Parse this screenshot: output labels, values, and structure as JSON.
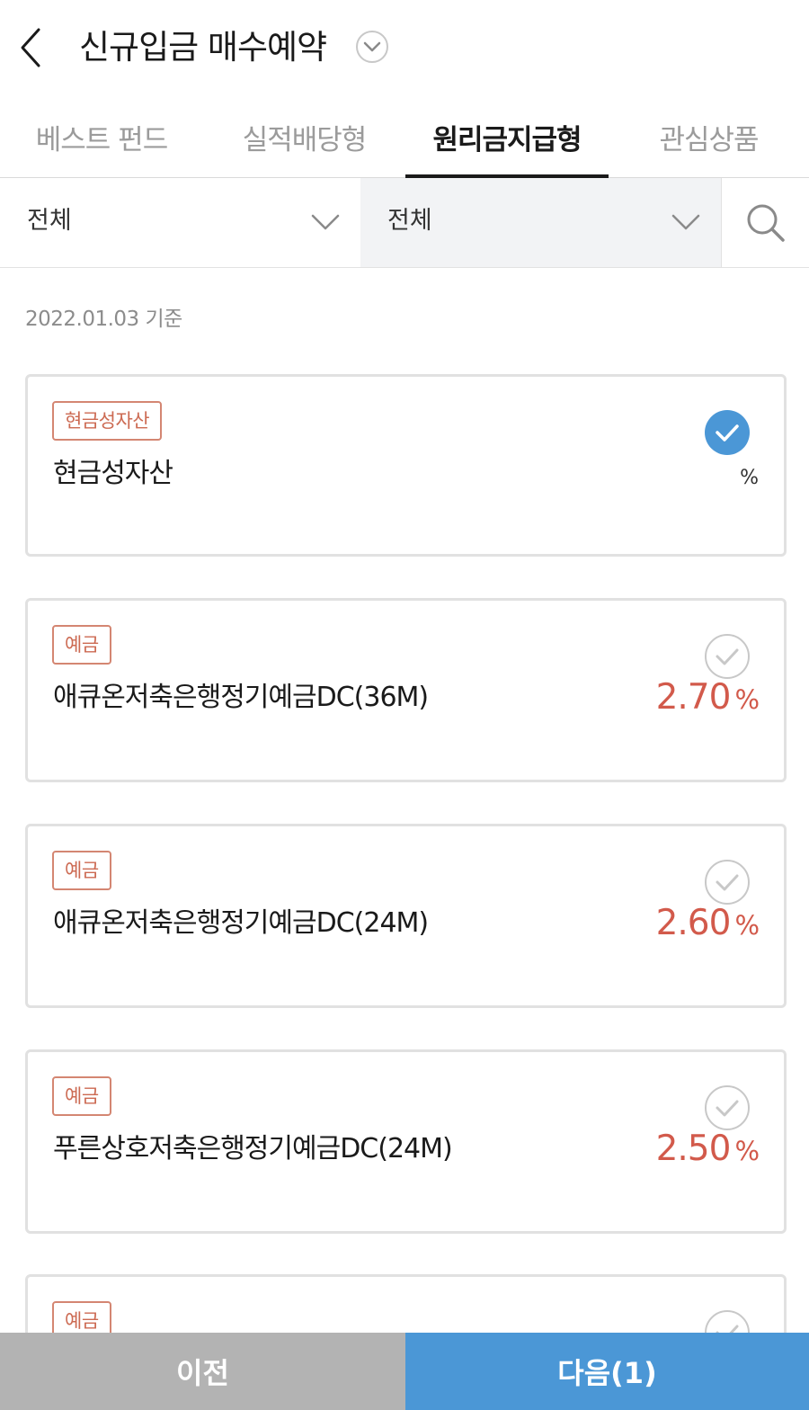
{
  "header": {
    "title": "신규입금 매수예약",
    "back_icon": "chevron-left-icon",
    "dropdown_icon": "chevron-down-circle-icon"
  },
  "tabs": [
    {
      "label": "베스트 펀드",
      "active": false
    },
    {
      "label": "실적배당형",
      "active": false
    },
    {
      "label": "원리금지급형",
      "active": true
    },
    {
      "label": "관심상품",
      "active": false
    }
  ],
  "filters": {
    "select_1": "전체",
    "select_2": "전체",
    "search_icon": "search-icon"
  },
  "base_date": "2022.01.03 기준",
  "products": [
    {
      "badge": "현금성자산",
      "name": "현금성자산",
      "rate": "",
      "unit": "%",
      "selected": true
    },
    {
      "badge": "예금",
      "name": "애큐온저축은행정기예금DC(36M)",
      "rate": "2.70",
      "unit": "%",
      "selected": false
    },
    {
      "badge": "예금",
      "name": "애큐온저축은행정기예금DC(24M)",
      "rate": "2.60",
      "unit": "%",
      "selected": false
    },
    {
      "badge": "예금",
      "name": "푸른상호저축은행정기예금DC(24M)",
      "rate": "2.50",
      "unit": "%",
      "selected": false
    },
    {
      "badge": "예금",
      "name": "",
      "rate": "",
      "unit": "",
      "selected": false
    }
  ],
  "buttons": {
    "prev": "이전",
    "next": "다음(1)"
  },
  "colors": {
    "accent_blue": "#4b97d6",
    "rate_red": "#d25a4b",
    "badge_red": "#cc6a52",
    "prev_gray": "#b3b3b3"
  }
}
